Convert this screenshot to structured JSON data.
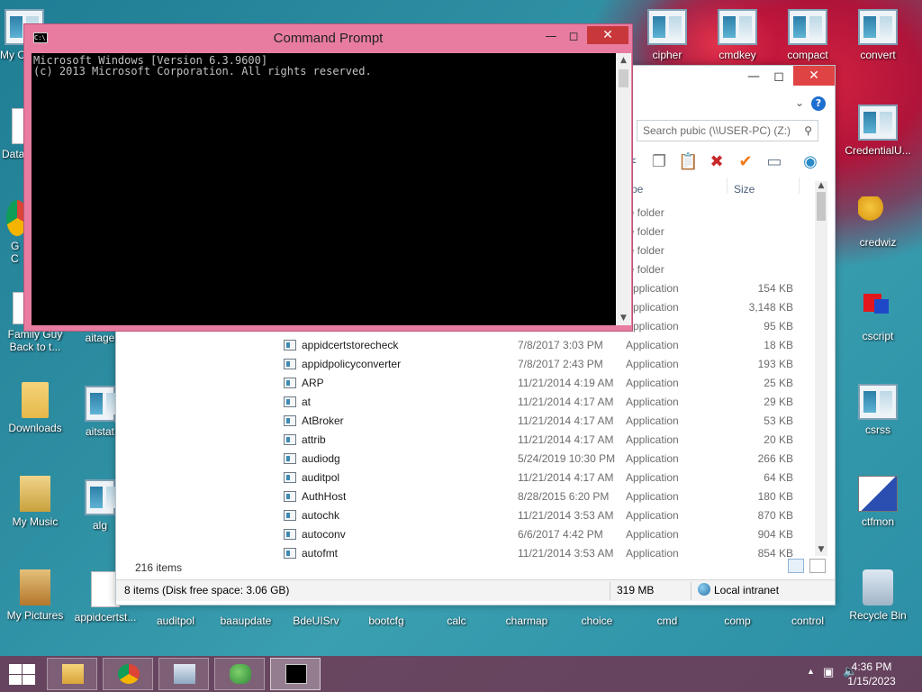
{
  "desktop": {
    "left_icons": [
      {
        "label": "My C",
        "icon": "computer-icon"
      },
      {
        "label": "Data",
        "icon": "data-icon"
      },
      {
        "label": "G C",
        "icon": "chrome-icon"
      },
      {
        "label": "Family Guy Back to t...",
        "icon": "video-icon"
      },
      {
        "label": "Downloads",
        "icon": "folder-icon"
      },
      {
        "label": "My Music",
        "icon": "music-icon"
      },
      {
        "label": "My Pictures",
        "icon": "pictures-icon"
      }
    ],
    "second_col": [
      {
        "label": "aitage",
        "icon": "app-icon"
      },
      {
        "label": "aitstat",
        "icon": "app-icon"
      },
      {
        "label": "alg",
        "icon": "app-icon"
      },
      {
        "label": "appidcertst...",
        "icon": "document-icon"
      }
    ],
    "bottom_row": [
      "auditpol",
      "baaupdate",
      "BdeUISrv",
      "bootcfg",
      "calc",
      "charmap",
      "choice",
      "cmd",
      "comp",
      "control"
    ],
    "top_row": [
      "cipher",
      "cmdkey",
      "compact",
      "convert"
    ],
    "right_col": [
      {
        "label": "CredentialU...",
        "icon": "app-icon"
      },
      {
        "label": "credwiz",
        "icon": "key-icon"
      },
      {
        "label": "cscript",
        "icon": "shapes-icon"
      },
      {
        "label": "csrss",
        "icon": "app-icon"
      },
      {
        "label": "ctfmon",
        "icon": "pen-icon"
      },
      {
        "label": "Recycle Bin",
        "icon": "recycle-bin-icon"
      }
    ]
  },
  "cmd": {
    "title": "Command Prompt",
    "line1": "Microsoft Windows [Version 6.3.9600]",
    "line2": "(c) 2013 Microsoft Corporation. All rights reserved.",
    "icon_text": "C:\\."
  },
  "explorer": {
    "search_placeholder": "Search pubic (\\\\USER-PC) (Z:)",
    "columns": {
      "type": "ype",
      "size": "Size"
    },
    "partial_rows": [
      {
        "type": "le folder",
        "size": ""
      },
      {
        "type": "le folder",
        "size": ""
      },
      {
        "type": "le folder",
        "size": ""
      },
      {
        "type": "le folder",
        "size": ""
      },
      {
        "type": "Application",
        "size": "154 KB"
      },
      {
        "type": "Application",
        "size": "3,148 KB"
      },
      {
        "type": "Application",
        "size": "95 KB"
      }
    ],
    "rows": [
      {
        "name": "appidcertstorecheck",
        "date": "7/8/2017 3:03 PM",
        "type": "Application",
        "size": "18 KB"
      },
      {
        "name": "appidpolicyconverter",
        "date": "7/8/2017 2:43 PM",
        "type": "Application",
        "size": "193 KB"
      },
      {
        "name": "ARP",
        "date": "11/21/2014 4:19 AM",
        "type": "Application",
        "size": "25 KB"
      },
      {
        "name": "at",
        "date": "11/21/2014 4:17 AM",
        "type": "Application",
        "size": "29 KB"
      },
      {
        "name": "AtBroker",
        "date": "11/21/2014 4:17 AM",
        "type": "Application",
        "size": "53 KB"
      },
      {
        "name": "attrib",
        "date": "11/21/2014 4:17 AM",
        "type": "Application",
        "size": "20 KB"
      },
      {
        "name": "audiodg",
        "date": "5/24/2019 10:30 PM",
        "type": "Application",
        "size": "266 KB"
      },
      {
        "name": "auditpol",
        "date": "11/21/2014 4:17 AM",
        "type": "Application",
        "size": "64 KB"
      },
      {
        "name": "AuthHost",
        "date": "8/28/2015 6:20 PM",
        "type": "Application",
        "size": "180 KB"
      },
      {
        "name": "autochk",
        "date": "11/21/2014 3:53 AM",
        "type": "Application",
        "size": "870 KB"
      },
      {
        "name": "autoconv",
        "date": "6/6/2017 4:42 PM",
        "type": "Application",
        "size": "904 KB"
      },
      {
        "name": "autofmt",
        "date": "11/21/2014 3:53 AM",
        "type": "Application",
        "size": "854 KB"
      }
    ],
    "items_count": "216 items",
    "status_left": "8 items (Disk free space: 3.06 GB)",
    "status_size": "319 MB",
    "status_zone": "Local intranet"
  },
  "taskbar": {
    "time": "4:36 PM",
    "date": "1/15/2023",
    "apps": [
      "file-explorer-icon",
      "chrome-icon",
      "resource-monitor-icon",
      "network-users-icon",
      "command-prompt-icon"
    ]
  }
}
